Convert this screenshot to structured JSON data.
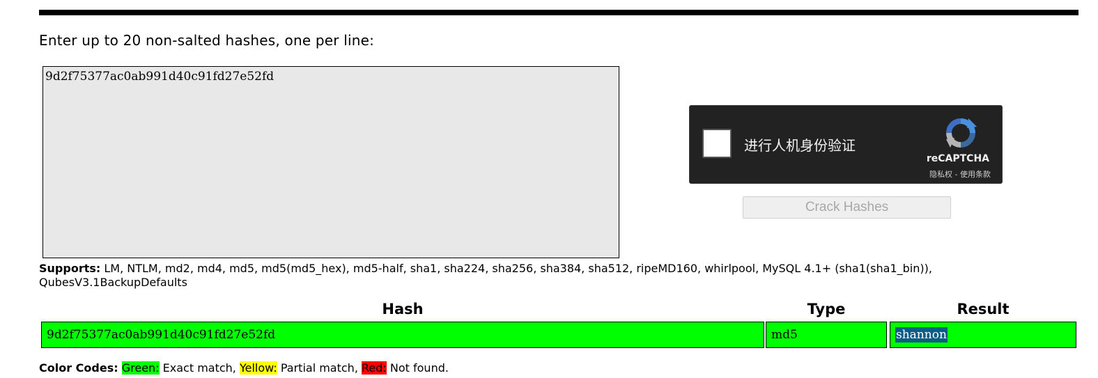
{
  "form": {
    "prompt": "Enter up to 20 non-salted hashes, one per line:",
    "textarea_value": "9d2f75377ac0ab991d40c91fd27e52fd",
    "crack_button_label": "Crack Hashes"
  },
  "recaptcha": {
    "label": "进行人机身份验证",
    "brand": "reCAPTCHA",
    "privacy_link": "隐私权",
    "separator": " - ",
    "terms_link": "使用条款",
    "logo_icon": "recaptcha-logo-icon",
    "colors": {
      "background": "#222222",
      "logo_blue": "#4a90e2",
      "logo_gray": "#b5b5b5"
    }
  },
  "supports": {
    "label": "Supports:",
    "text": "LM, NTLM, md2, md4, md5, md5(md5_hex), md5-half, sha1, sha224, sha256, sha384, sha512, ripeMD160, whirlpool, MySQL 4.1+ (sha1(sha1_bin)), QubesV3.1BackupDefaults"
  },
  "results": {
    "headers": {
      "hash": "Hash",
      "type": "Type",
      "result": "Result"
    },
    "rows": [
      {
        "hash": "9d2f75377ac0ab991d40c91fd27e52fd",
        "type": "md5",
        "result": "shannon",
        "status_color": "#00ff00"
      }
    ]
  },
  "color_codes": {
    "label": "Color Codes:",
    "green": "Green:",
    "green_desc": " Exact match, ",
    "yellow": "Yellow:",
    "yellow_desc": " Partial match, ",
    "red": "Red:",
    "red_desc": " Not found.",
    "colors": {
      "green": "#00ff00",
      "yellow": "#ffff00",
      "red": "#ff0000"
    }
  }
}
